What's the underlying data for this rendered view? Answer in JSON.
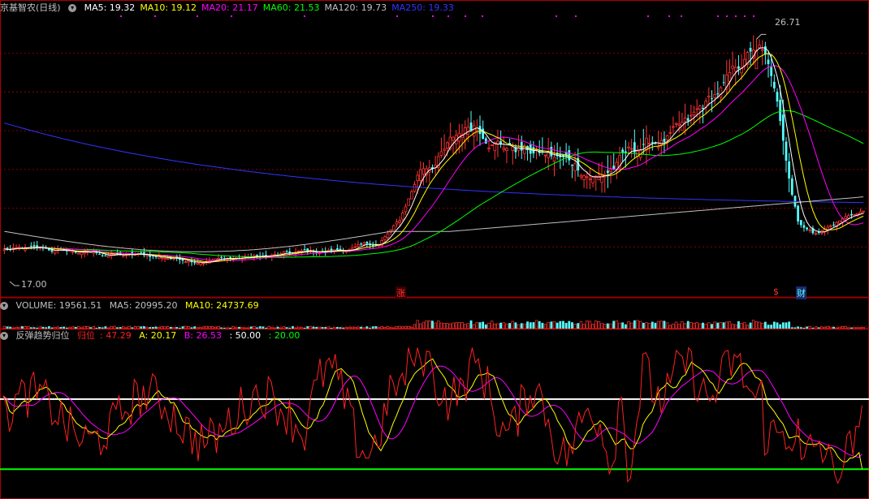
{
  "header": {
    "stock_title": "京基智农(日线)",
    "ma": [
      {
        "label": "MA5: 19.32",
        "color": "#ffffff"
      },
      {
        "label": "MA10: 19.12",
        "color": "#ffff00"
      },
      {
        "label": "MA20: 21.17",
        "color": "#ff00ff"
      },
      {
        "label": "MA60: 21.53",
        "color": "#00ff00"
      },
      {
        "label": "MA120: 19.73",
        "color": "#c0c0c0"
      },
      {
        "label": "MA250: 19.33",
        "color": "#3333ff"
      }
    ]
  },
  "volume_header": {
    "title": "VOLUME: 19561.51",
    "ma5": "MA5: 20995.20",
    "ma10": "MA10: 24737.69",
    "colors": {
      "title": "#c0c0c0",
      "ma5": "#c0c0c0",
      "ma10": "#ffff00"
    }
  },
  "indicator_header": {
    "title": "反弹趋势归位",
    "guiwei_label": "归位",
    "guiwei_value": ": 47.29",
    "a": "A: 20.17",
    "b": "B: 26.53",
    "line50": ": 50.00",
    "line20": ": 20.00",
    "colors": {
      "guiwei": "#ff2020",
      "a": "#ffff00",
      "b": "#ff00ff",
      "line50": "#ffffff",
      "line20": "#00ff00"
    }
  },
  "annotations": {
    "high": "26.71",
    "low": "17.00",
    "zhang": "涨",
    "dollar": "$",
    "cai": "财"
  },
  "chart_data": [
    {
      "type": "candlestick",
      "name": "price",
      "num_bars": 240,
      "ylim": [
        15.8,
        27.8
      ],
      "high_value": 26.71,
      "low_value": 17.0,
      "trajectory": [
        [
          0,
          17.4
        ],
        [
          30,
          17.2
        ],
        [
          60,
          17.0
        ],
        [
          90,
          17.1
        ],
        [
          110,
          17.3
        ],
        [
          126,
          17.6
        ],
        [
          133,
          18.6
        ],
        [
          140,
          20.9
        ],
        [
          148,
          21.8
        ],
        [
          158,
          23.0
        ],
        [
          168,
          22.3
        ],
        [
          180,
          21.7
        ],
        [
          200,
          20.7
        ],
        [
          214,
          21.9
        ],
        [
          230,
          22.6
        ],
        [
          236,
          23.5
        ],
        [
          246,
          25.0
        ],
        [
          253,
          26.3
        ],
        [
          257,
          25.3
        ],
        [
          262,
          22.0
        ],
        [
          267,
          18.7
        ],
        [
          272,
          18.2
        ],
        [
          278,
          18.5
        ],
        [
          285,
          19.0
        ],
        [
          290,
          19.1
        ]
      ],
      "ma_colors": {
        "ma5": "#ffffff",
        "ma10": "#ffff00",
        "ma20": "#ff00ff",
        "ma60": "#00ff00",
        "ma120": "#c0c0c0",
        "ma250": "#3333ff"
      },
      "up_color": "#ff3232",
      "down_color": "#54ffff"
    },
    {
      "type": "bar",
      "name": "volume"
    },
    {
      "type": "line",
      "name": "反弹趋势归位",
      "ylim": [
        10,
        75
      ],
      "reference_lines": [
        50,
        20
      ],
      "series": [
        {
          "name": "归位",
          "color": "#ff2020",
          "last": 47.29
        },
        {
          "name": "A",
          "color": "#ffff00",
          "last": 20.17
        },
        {
          "name": "B",
          "color": "#ff00ff",
          "last": 26.53
        }
      ]
    }
  ]
}
